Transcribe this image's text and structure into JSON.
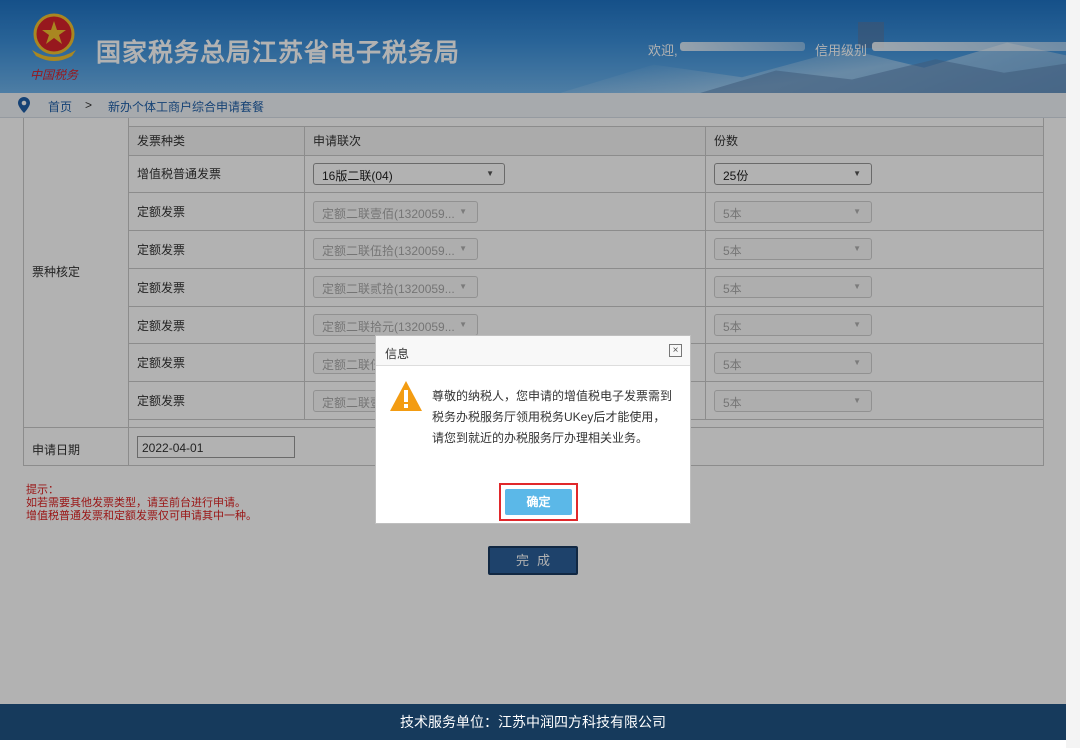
{
  "header": {
    "title": "国家税务总局江苏省电子税务局",
    "brand_sub": "中国税务",
    "welcome": "欢迎,",
    "credit_label": "信用级别"
  },
  "breadcrumb": {
    "home": "首页",
    "separator": ">",
    "current": "新办个体工商户综合申请套餐"
  },
  "form": {
    "section_label": "票种核定",
    "headers": [
      "发票种类",
      "申请联次",
      "份数"
    ],
    "rows": [
      {
        "type": "增值税普通发票",
        "copies": "16版二联(04)",
        "qty": "25份",
        "enabled": true
      },
      {
        "type": "定额发票",
        "copies": "定额二联壹佰(1320059...",
        "qty": "5本",
        "enabled": false
      },
      {
        "type": "定额发票",
        "copies": "定额二联伍拾(1320059...",
        "qty": "5本",
        "enabled": false
      },
      {
        "type": "定额发票",
        "copies": "定额二联贰拾(1320059...",
        "qty": "5本",
        "enabled": false
      },
      {
        "type": "定额发票",
        "copies": "定额二联拾元(1320059...",
        "qty": "5本",
        "enabled": false
      },
      {
        "type": "定额发票",
        "copies": "定额二联伍",
        "qty": "5本",
        "enabled": false
      },
      {
        "type": "定额发票",
        "copies": "定额二联壹",
        "qty": "5本",
        "enabled": false
      }
    ],
    "date_label": "申请日期",
    "date_value": "2022-04-01"
  },
  "tips": {
    "title": "提示：",
    "line1": "如若需要其他发票类型，请至前台进行申请。",
    "line2": "增值税普通发票和定额发票仅可申请其中一种。"
  },
  "done_label": "完成",
  "footer": "技术服务单位：江苏中润四方科技有限公司",
  "modal": {
    "title": "信息",
    "close": "×",
    "message": "尊敬的纳税人，您申请的增值税电子发票需到税务办税服务厅领用税务UKey后才能使用，请您到就近的办税服务厅办理相关业务。",
    "ok_label": "确定"
  },
  "colors": {
    "header_blue": "#1f73c4",
    "footer_navy": "#163a5c",
    "ok_button": "#5bb8e8",
    "highlight_red": "#e0282b",
    "warning_orange": "#f39c12"
  },
  "icons": [
    "emblem-icon",
    "location-pin-icon",
    "dropdown-arrow-icon",
    "close-icon",
    "warning-icon"
  ]
}
